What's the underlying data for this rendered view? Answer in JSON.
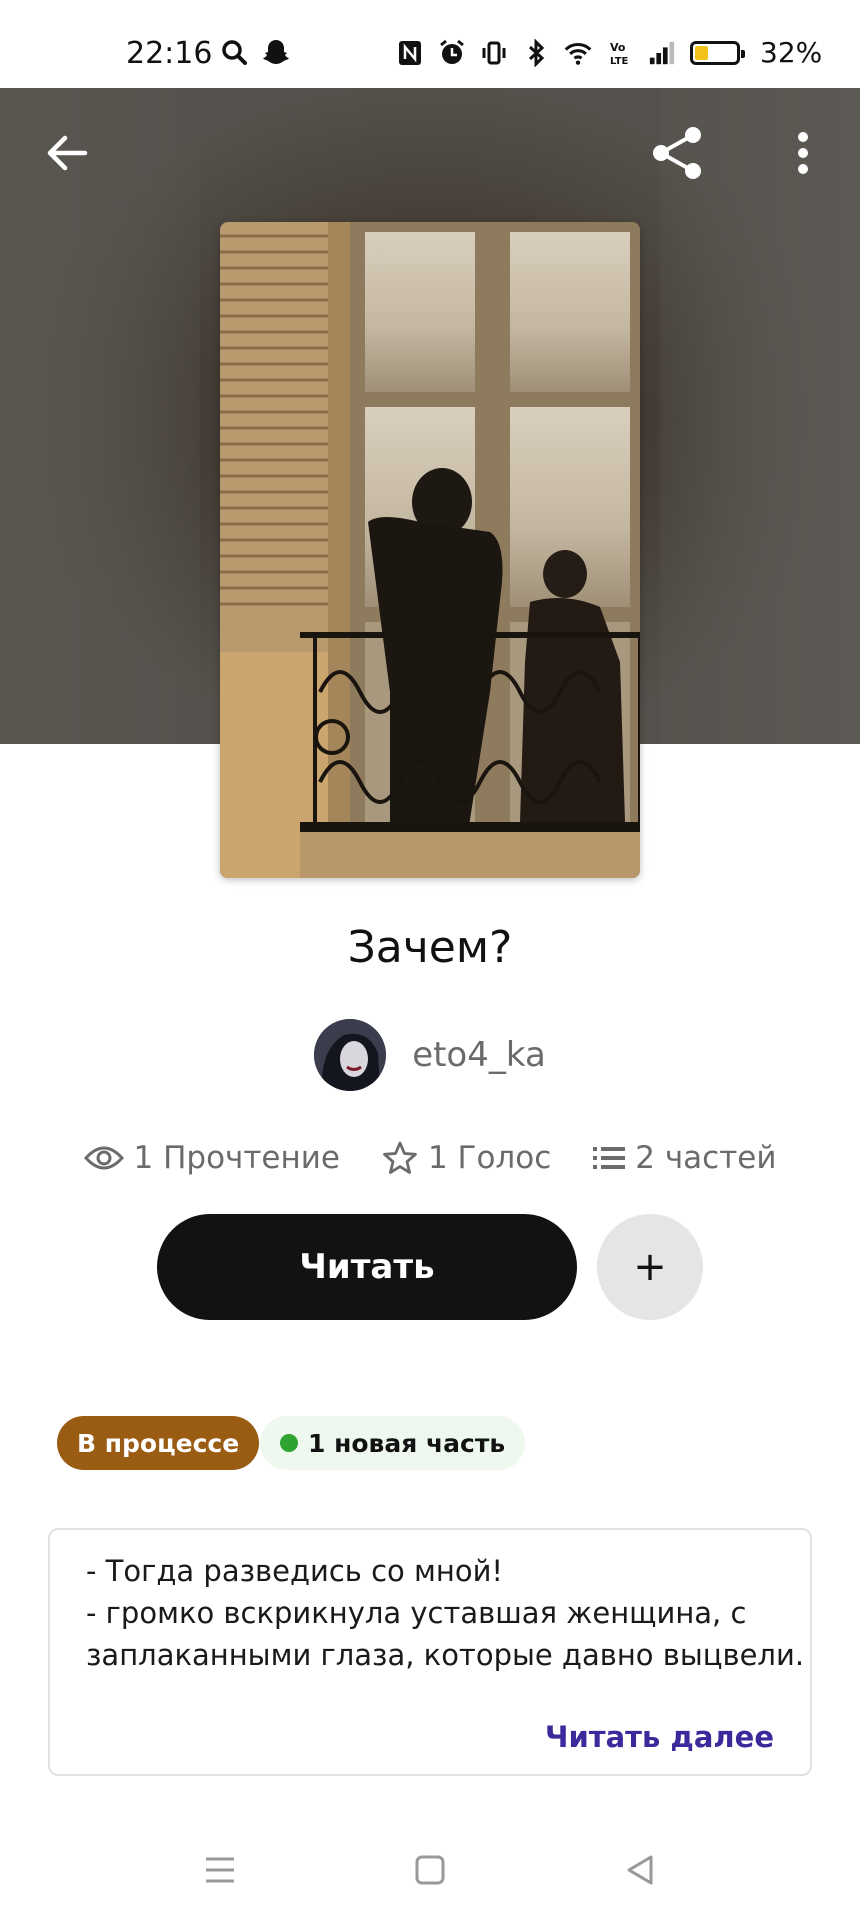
{
  "status_bar": {
    "time": "22:16",
    "battery_percent": "32%",
    "battery_level": 0.32,
    "battery_color": "#f2c21b"
  },
  "header": {
    "back_icon": "arrow-left-icon",
    "share_icon": "share-icon",
    "menu_icon": "more-vert-icon"
  },
  "story": {
    "title": "Зачем?",
    "author": "eto4_ka",
    "reads": "1 Прочтение",
    "votes": "1 Голос",
    "parts": "2 частей"
  },
  "actions": {
    "read_label": "Читать",
    "add_label": "+"
  },
  "tags": {
    "status": "В процессе",
    "new_part": "1 новая часть"
  },
  "excerpt": {
    "lines": [
      "- Тогда разведись со мной!",
      "- громко вскрикнула уставшая женщина, с",
      "заплаканными глаза, которые давно выцвели."
    ],
    "read_more": "Читать далее"
  },
  "colors": {
    "status_tag": "#9a5b12",
    "read_more": "#3a2a9c",
    "new_dot": "#2fa32f",
    "read_button": "#121212"
  }
}
